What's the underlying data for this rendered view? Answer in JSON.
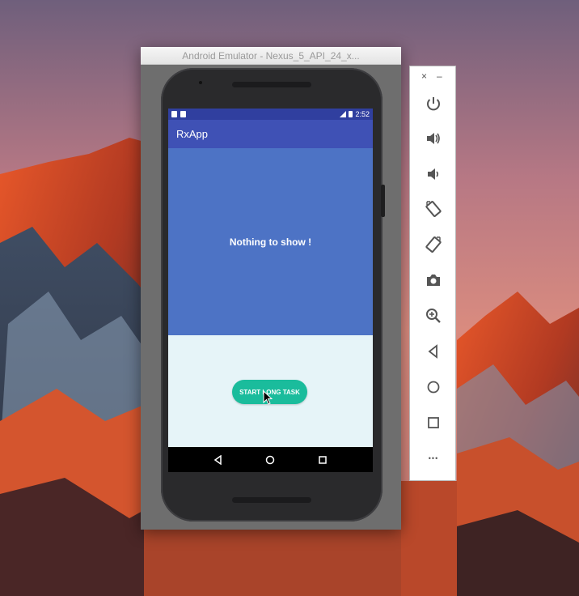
{
  "window": {
    "title": "Android Emulator - Nexus_5_API_24_x..."
  },
  "status_bar": {
    "time": "2:52"
  },
  "app": {
    "title": "RxApp",
    "message": "Nothing to show !",
    "button_label": "START LONG TASK"
  },
  "control_panel": {
    "close": "×",
    "minimize": "–",
    "more": "•••"
  },
  "colors": {
    "app_bar": "#3f51b5",
    "status_bar": "#303f9f",
    "content_top": "#4d73c5",
    "content_bottom": "#e6f4f8",
    "button": "#1abc9c",
    "panel_icon": "#555555"
  },
  "icons": [
    "power-icon",
    "volume-up-icon",
    "volume-down-icon",
    "rotate-left-icon",
    "rotate-right-icon",
    "camera-icon",
    "zoom-icon",
    "back-icon",
    "home-icon",
    "overview-icon",
    "more-icon"
  ]
}
